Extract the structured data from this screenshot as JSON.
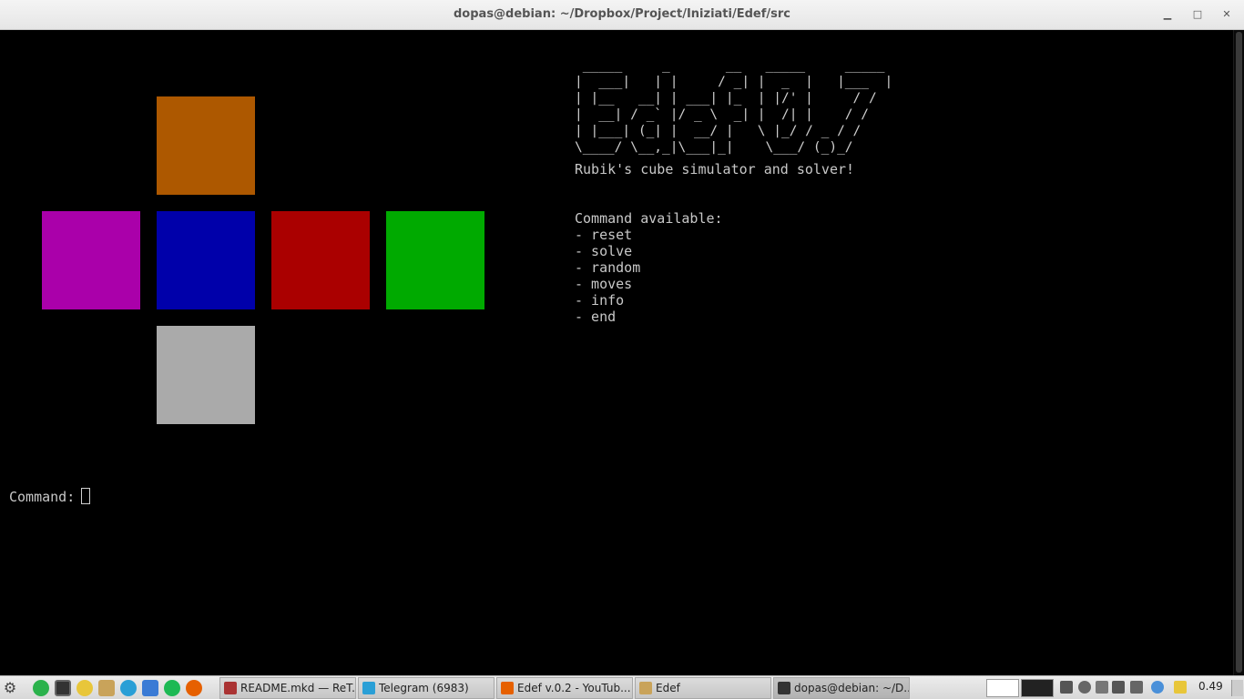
{
  "window": {
    "title": "dopas@debian: ~/Dropbox/Project/Iniziati/Edef/src",
    "minimize_glyph": "▁",
    "maximize_glyph": "□",
    "close_glyph": "✕"
  },
  "cube_colors": {
    "top": "#ad5800",
    "left": "#aa00aa",
    "front": "#0000aa",
    "right": "#aa0000",
    "back": "#00aa00",
    "bottom": "#aaaaaa"
  },
  "terminal": {
    "banner": " _____     _       __   _____     _____ \n|  ___|   | |     / _| |  _  |   |___  |\n| |__   __| | ___| |_  | |/' |     / / \n|  __| / _` |/ _ \\  _| |  /| |    / /  \n| |___| (_| |  __/ |   \\ |_/ / _ / /   \n\\____/ \\__,_|\\___|_|    \\___/ (_)_/    ",
    "tagline": "Rubik's cube simulator and solver!",
    "commands_header": "Command available:",
    "commands": [
      "- reset",
      "- solve",
      "- random",
      "- moves",
      "- info",
      "- end"
    ],
    "prompt_label": "Command:"
  },
  "taskbar": {
    "tasks": [
      {
        "label": "README.mkd — ReT...",
        "icon": "retext-icon",
        "color": "#a33"
      },
      {
        "label": "Telegram (6983)",
        "icon": "telegram-icon",
        "color": "#2a9fd6"
      },
      {
        "label": "Edef v.0.2 - YouTub...",
        "icon": "firefox-icon",
        "color": "#e66000"
      },
      {
        "label": "Edef",
        "icon": "folder-icon",
        "color": "#c9a35a"
      },
      {
        "label": "dopas@debian: ~/D...",
        "icon": "terminal-icon",
        "color": "#333"
      }
    ],
    "clock": "0.49"
  }
}
